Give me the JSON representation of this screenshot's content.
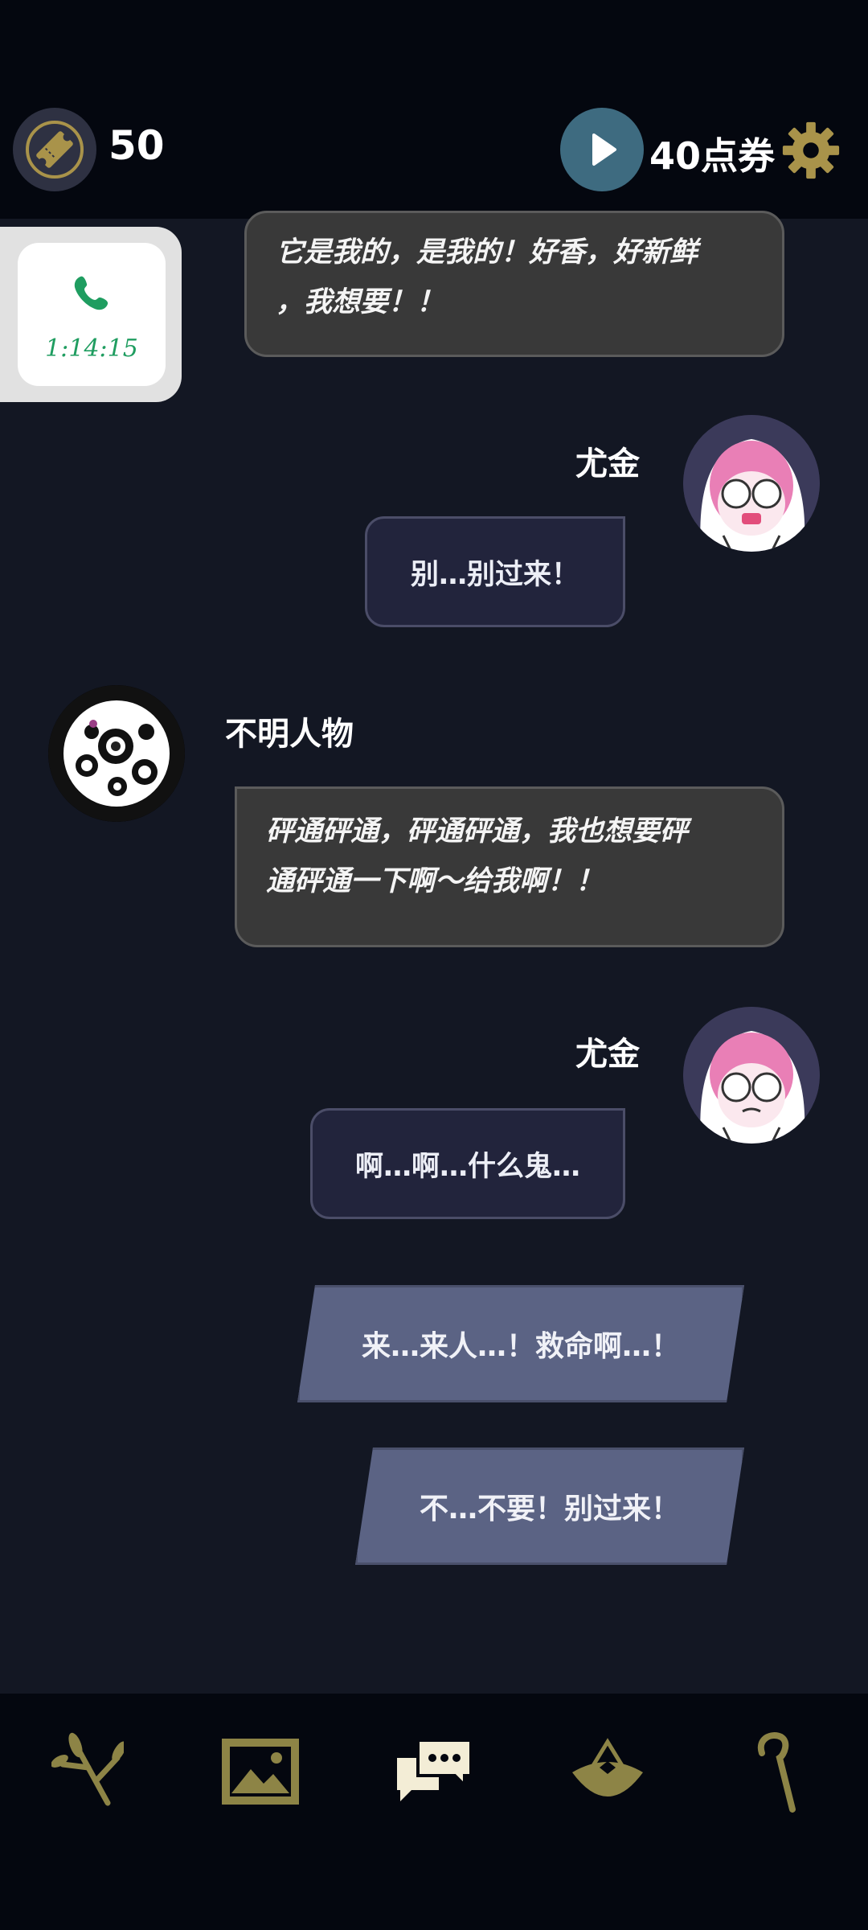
{
  "header": {
    "ticket_count": "50",
    "points_label": "40点券"
  },
  "call_widget": {
    "timer": "1:14:15"
  },
  "messages": [
    {
      "speaker": "",
      "text_line1": "它是我的，是我的！好香，好新鲜",
      "text_line2": "，我想要！！"
    },
    {
      "speaker": "尤金",
      "text": "别…别过来！"
    },
    {
      "speaker": "不明人物",
      "text_line1": "砰通砰通，砰通砰通，我也想要砰",
      "text_line2": "通砰通一下啊～给我啊！！"
    },
    {
      "speaker": "尤金",
      "text": "啊…啊…什么鬼…"
    }
  ],
  "choices": [
    {
      "text": "来…来人…！救命啊…！"
    },
    {
      "text": "不…不要！别过来！"
    }
  ],
  "bottom_nav": {
    "icons": [
      "branch-icon",
      "gallery-icon",
      "chat-icon",
      "hat-icon",
      "cane-icon"
    ],
    "active_color": "#f3edd6",
    "inactive_color": "#8d8446"
  },
  "colors": {
    "accent_gold": "#a9934a",
    "call_green": "#1f9d60"
  }
}
